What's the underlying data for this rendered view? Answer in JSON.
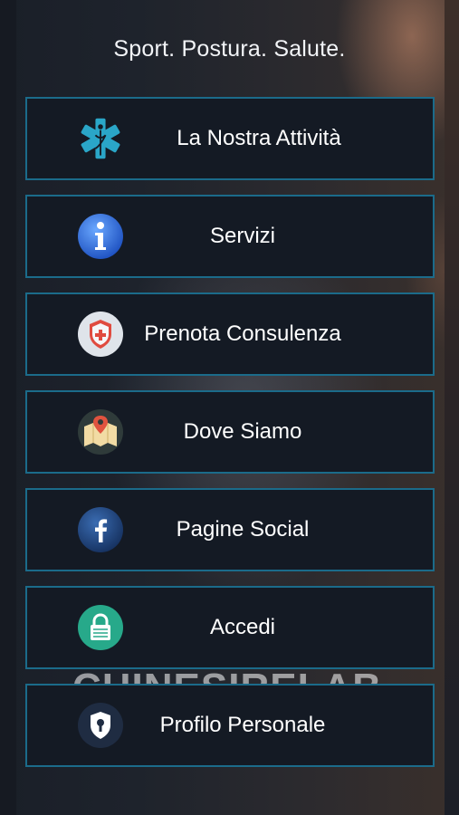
{
  "tagline": "Sport. Postura. Salute.",
  "watermark": "CHINESIRELAB",
  "menu": [
    {
      "label": "La Nostra Attività",
      "icon": "medical-star-of-life-icon"
    },
    {
      "label": "Servizi",
      "icon": "info-icon"
    },
    {
      "label": "Prenota Consulenza",
      "icon": "medical-shield-icon"
    },
    {
      "label": "Dove Siamo",
      "icon": "map-pin-icon"
    },
    {
      "label": "Pagine Social",
      "icon": "facebook-icon"
    },
    {
      "label": "Accedi",
      "icon": "lock-icon"
    },
    {
      "label": "Profilo Personale",
      "icon": "user-shield-icon"
    }
  ],
  "colors": {
    "button_bg": "#141a24",
    "button_border": "#1b6b8a",
    "text": "#ffffff"
  }
}
